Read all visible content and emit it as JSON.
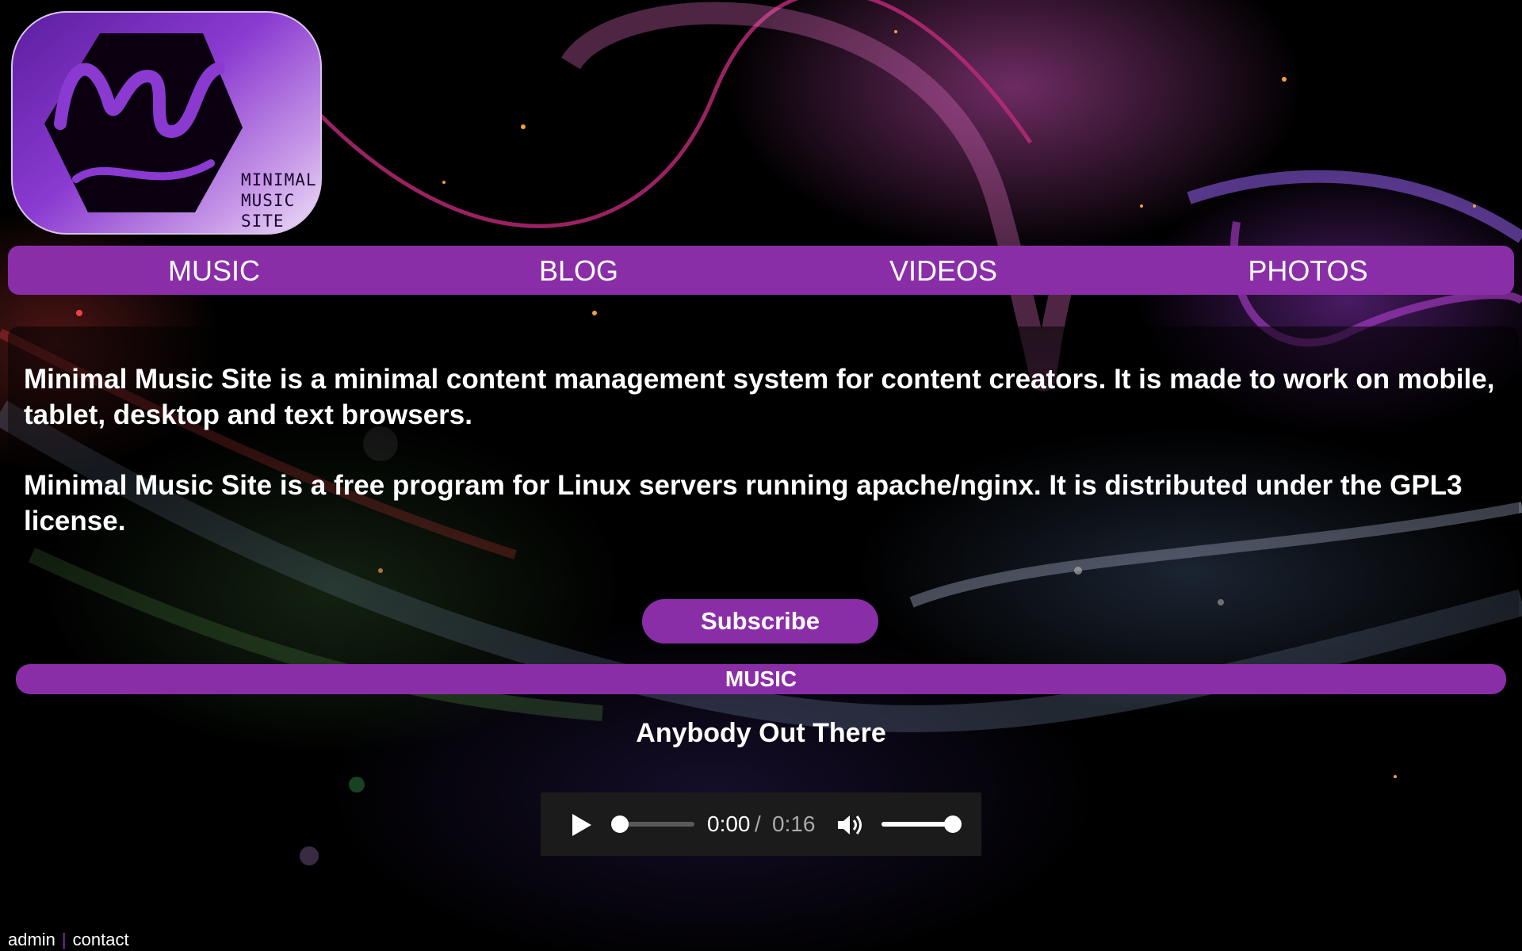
{
  "logo": {
    "text": "MINIMAL\nMUSIC\nSITE"
  },
  "nav": {
    "items": [
      {
        "label": "MUSIC"
      },
      {
        "label": "BLOG"
      },
      {
        "label": "VIDEOS"
      },
      {
        "label": "PHOTOS"
      }
    ]
  },
  "intro": {
    "paragraph_1": "Minimal Music Site is a minimal content management system for content creators. It is made to work on mobile, tablet, desktop and text browsers.",
    "paragraph_2": "Minimal Music Site is a free program for Linux servers running apache/nginx. It is distributed under the GPL3 license."
  },
  "subscribe_label": "Subscribe",
  "section": {
    "title": "MUSIC"
  },
  "track": {
    "title": "Anybody Out There"
  },
  "player": {
    "current_time": "0:00",
    "separator": "/",
    "total_time": "0:16",
    "progress": 0,
    "volume": 1.0,
    "play_icon": "play-icon",
    "volume_icon": "volume-icon"
  },
  "footer": {
    "admin_label": "admin",
    "separator": "|",
    "contact_label": "contact"
  },
  "colors": {
    "accent": "#8a2ea8",
    "background": "#000000",
    "player_bg": "#1b1b1b"
  }
}
